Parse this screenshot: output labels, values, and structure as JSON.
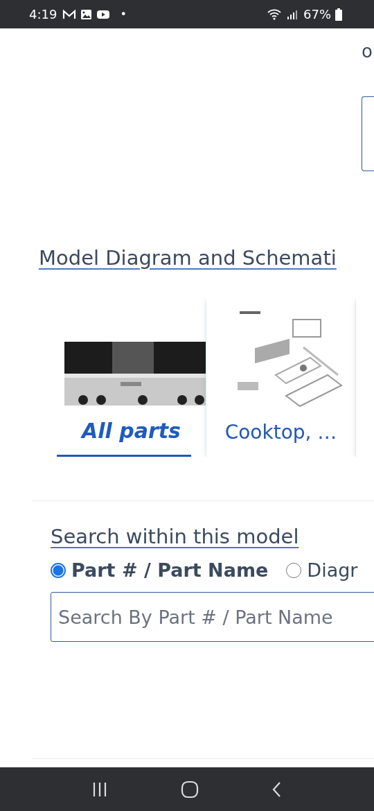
{
  "status_bar": {
    "time": "4:19",
    "dot": "•",
    "battery": "67%"
  },
  "edge_text": "o",
  "diagram_section": {
    "title": "Model Diagram and Schemati",
    "cards": [
      {
        "kind": "photo",
        "label": "All parts",
        "selected": true
      },
      {
        "kind": "diagram",
        "label": "Cooktop, …",
        "selected": false
      },
      {
        "kind": "blank",
        "selected": false
      }
    ]
  },
  "search_section": {
    "title": "Search within this model",
    "options": [
      {
        "label": "Part # / Part Name",
        "selected": true
      },
      {
        "label": "Diagr",
        "selected": false
      }
    ],
    "placeholder": "Search By Part # / Part Name"
  }
}
